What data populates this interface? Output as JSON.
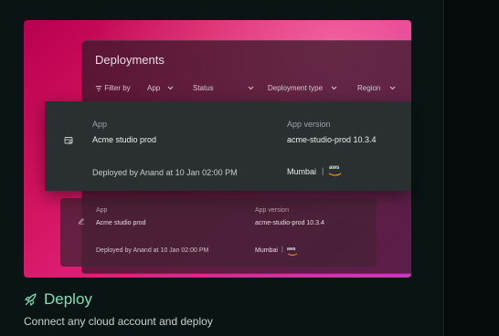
{
  "window": {
    "title": "Deployments"
  },
  "filters": {
    "filter_by": "Filter by",
    "app": "App",
    "status": "Status",
    "deployment_type": "Deployment type",
    "region": "Region"
  },
  "card": {
    "app_label": "App",
    "app_value": "Acme studio prod",
    "version_label": "App version",
    "version_value": "acme-studio-prod 10.3.4",
    "deployed_by": "Deployed by Anand at 10 Jan 02:00 PM",
    "region": "Mumbai",
    "provider": "aws"
  },
  "row2": {
    "app_label": "App",
    "app_value": "Acme studio prod",
    "version_label": "App version",
    "version_value": "acme-studio-prod 10.3.4",
    "deployed_by": "Deployed by Anand at 10 Jan 02:00 PM",
    "region": "Mumbai",
    "provider": "aws"
  },
  "feature": {
    "title": "Deploy",
    "description": "Connect any cloud account and deploy"
  },
  "colors": {
    "accent": "#7de0b4",
    "gradient_start": "#b8004f",
    "gradient_end": "#c93abf"
  }
}
